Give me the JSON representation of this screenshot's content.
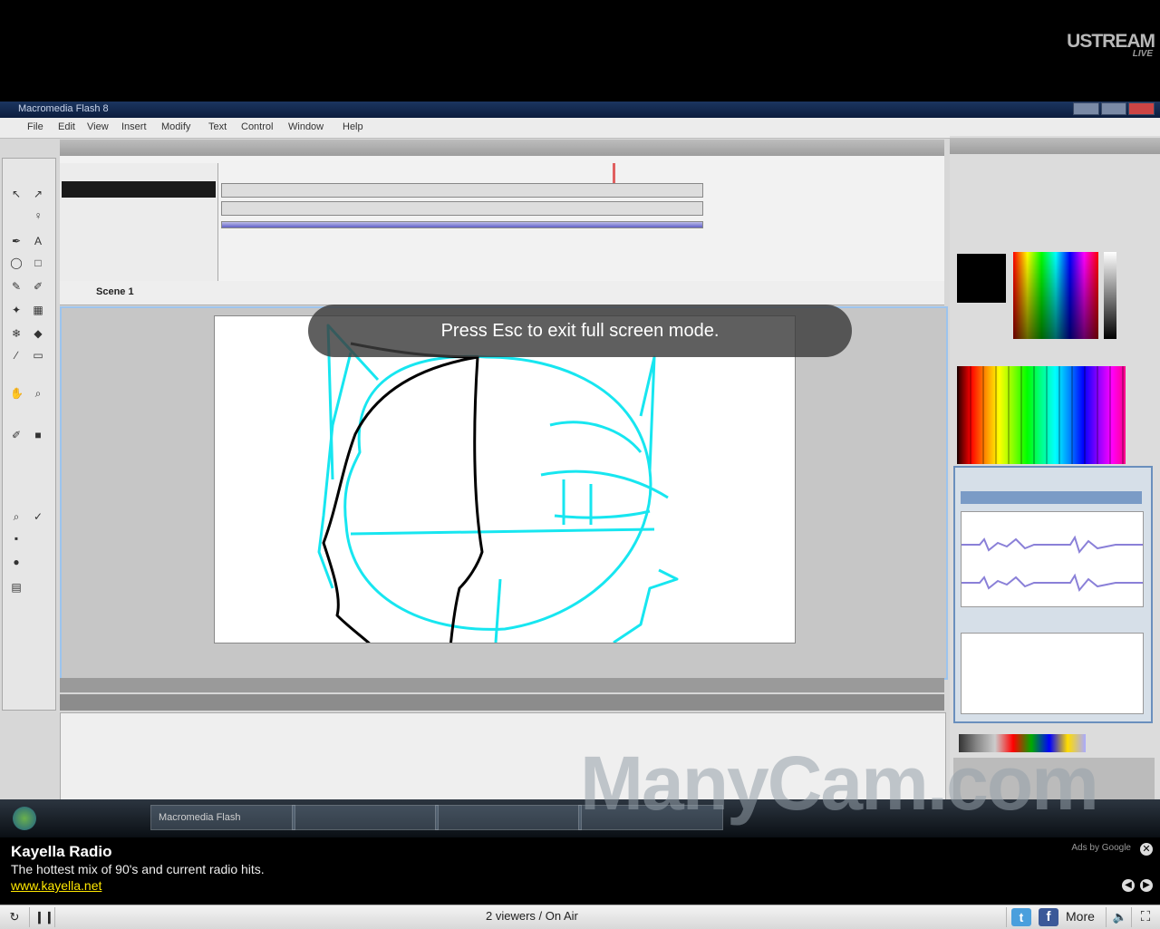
{
  "branding": {
    "logo": "USTREAM",
    "logo_sub": "LIVE"
  },
  "desktop": {
    "app_title": "Macromedia Flash 8",
    "menu": [
      "File",
      "Edit",
      "View",
      "Insert",
      "Modify",
      "Text",
      "Control",
      "Window",
      "Help"
    ],
    "scene_label": "Scene 1",
    "taskbar_items": [
      "Macromedia Flash",
      "",
      ""
    ],
    "watermark": "ManyCam.com"
  },
  "overlay": {
    "fullscreen_message": "Press Esc to exit full screen mode."
  },
  "ad": {
    "title": "Kayella Radio",
    "description": "The hottest mix of 90's and current radio hits.",
    "link": "www.kayella.net",
    "ads_by": "Ads by Google"
  },
  "player": {
    "status": "2 viewers / On Air",
    "twitter_glyph": "t",
    "facebook_glyph": "f",
    "more_label": "More"
  },
  "colors": {
    "sketch_cyan": "#17e6f0",
    "sketch_black": "#000000",
    "ad_link": "#ffe800"
  }
}
